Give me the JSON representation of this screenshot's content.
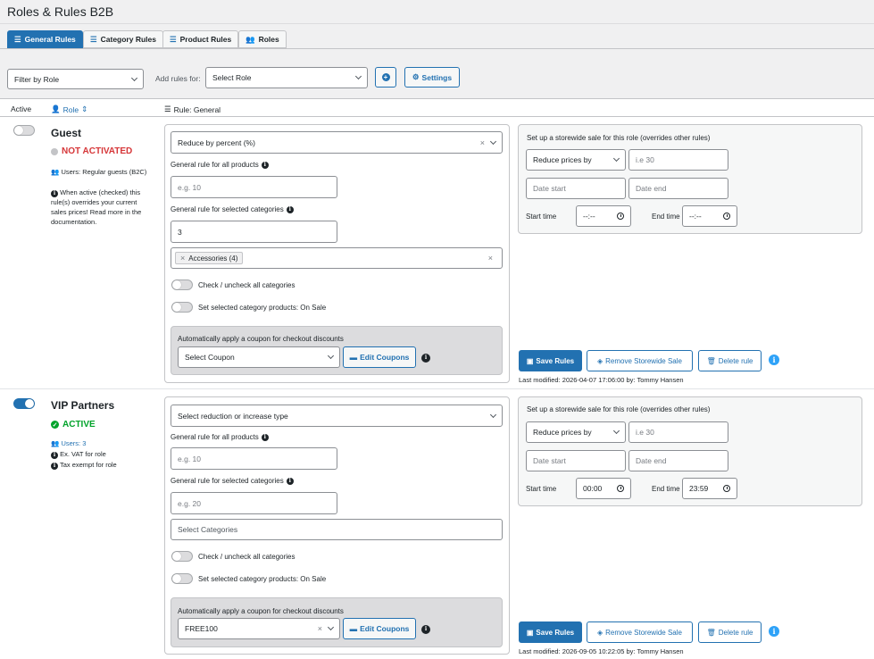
{
  "page": {
    "title": "Roles & Rules B2B"
  },
  "tabs": [
    {
      "label": "General Rules",
      "icon": "sliders-icon"
    },
    {
      "label": "Category Rules",
      "icon": "sliders-icon"
    },
    {
      "label": "Product Rules",
      "icon": "sliders-icon"
    },
    {
      "label": "Roles",
      "icon": "users-icon"
    }
  ],
  "toolbar": {
    "filter_role": "Filter by Role",
    "add_rules_label": "Add rules for:",
    "select_role": "Select Role",
    "add_icon": "plus-circle-icon",
    "settings_label": "Settings"
  },
  "table": {
    "col_active": "Active",
    "col_role": "Role",
    "col_rule": "Rule: General"
  },
  "shared": {
    "general_all_label": "General rule for all products",
    "general_cat_label": "General rule for selected categories",
    "check_all_label": "Check / uncheck all categories",
    "on_sale_label": "Set selected category products: On Sale",
    "coupon_label": "Automatically apply a coupon for checkout discounts",
    "edit_coupons": "Edit Coupons",
    "storewide_title": "Set up a storewide sale for this role (overrides other rules)",
    "reduce_by": "Reduce prices by",
    "value_placeholder": "i.e 30",
    "date_start": "Date start",
    "date_end": "Date end",
    "start_time": "Start time",
    "end_time": "End time",
    "save_rules": "Save Rules",
    "remove_sale": "Remove Storewide Sale",
    "delete_rule": "Delete rule"
  },
  "roles": [
    {
      "name": "Guest",
      "active": false,
      "status": "NOT ACTIVATED",
      "status_color": "#d63638",
      "users": "Users: Regular guests (B2C)",
      "note": [
        "When active (checked) this",
        "rule(s) overrides your current",
        "sales prices! Read more in the",
        "documentation."
      ],
      "reduction_type": "Reduce by percent (%)",
      "all_placeholder": "e.g. 10",
      "cat_value": "3",
      "category_tag": "Accessories  (4)",
      "coupon": "Select Coupon",
      "start_time": "--:--",
      "end_time": "--:--",
      "last_modified": "Last modified: 2026-04-07 17:06:00 by: Tommy Hansen"
    },
    {
      "name": "VIP Partners",
      "active": true,
      "status": "ACTIVE",
      "status_color": "#00a32a",
      "users": "Users: 3",
      "extra": [
        "Ex. VAT for role",
        "Tax exempt for role"
      ],
      "reduction_type": "Select reduction or increase type",
      "all_placeholder": "e.g. 10",
      "cat_placeholder": "e.g. 20",
      "categories_placeholder": "Select Categories",
      "coupon": "FREE100",
      "start_time": "00:00",
      "end_time": "23:59",
      "last_modified": "Last modified: 2026-09-05 10:22:05 by: Tommy Hansen"
    }
  ]
}
